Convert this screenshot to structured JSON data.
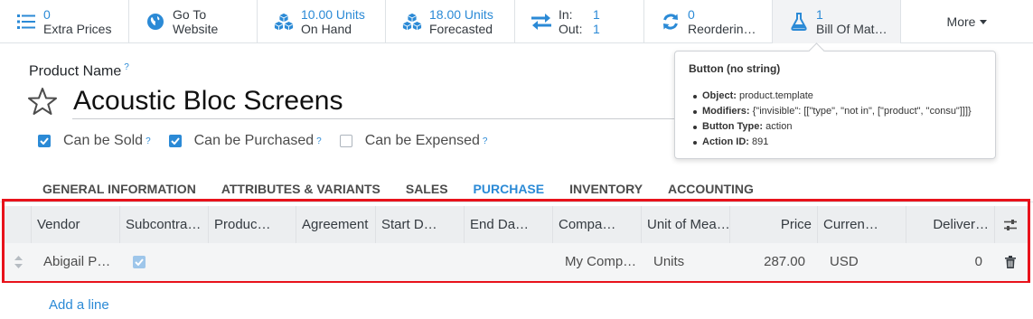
{
  "smart_buttons": {
    "extra_prices": {
      "value": "0",
      "label": "Extra Prices"
    },
    "website": {
      "line1": "Go To",
      "line2": "Website"
    },
    "on_hand": {
      "value": "10.00 Units",
      "label": "On Hand"
    },
    "forecasted": {
      "value": "18.00 Units",
      "label": "Forecasted"
    },
    "inout": {
      "in_label": "In:",
      "in_value": "1",
      "out_label": "Out:",
      "out_value": "1"
    },
    "reordering": {
      "value": "0",
      "label": "Reorderin…"
    },
    "bom": {
      "value": "1",
      "label": "Bill Of Mat…"
    },
    "more_label": "More"
  },
  "product": {
    "name_label": "Product Name",
    "help_mark": "?",
    "name": "Acoustic Bloc Screens",
    "can_be_sold": {
      "label": "Can be Sold",
      "checked": true
    },
    "can_be_purchased": {
      "label": "Can be Purchased",
      "checked": true
    },
    "can_be_expensed": {
      "label": "Can be Expensed",
      "checked": false
    }
  },
  "tabs": [
    {
      "label": "GENERAL INFORMATION"
    },
    {
      "label": "ATTRIBUTES & VARIANTS"
    },
    {
      "label": "SALES"
    },
    {
      "label": "PURCHASE",
      "active": true
    },
    {
      "label": "INVENTORY"
    },
    {
      "label": "ACCOUNTING"
    }
  ],
  "table": {
    "columns": [
      "Vendor",
      "Subcontra…",
      "Produc…",
      "Agreement",
      "Start D…",
      "End Da…",
      "Compa…",
      "Unit of Mea…",
      "Price",
      "Curren…",
      "Deliver…"
    ],
    "rows": [
      {
        "vendor": "Abigail P…",
        "subcontractor": true,
        "product": "",
        "agreement": "",
        "start": "",
        "end": "",
        "company": "My Comp…",
        "uom": "Units",
        "price": "287.00",
        "currency": "USD",
        "delivery": "0"
      }
    ],
    "add_line": "Add a line"
  },
  "tooltip": {
    "title": "Button (no string)",
    "items": [
      {
        "key": "Object:",
        "value": "product.template"
      },
      {
        "key": "Modifiers:",
        "value": "{\"invisible\": [[\"type\", \"not in\", [\"product\", \"consu\"]]]}"
      },
      {
        "key": "Button Type:",
        "value": "action"
      },
      {
        "key": "Action ID:",
        "value": "891"
      }
    ]
  },
  "colors": {
    "accent": "#2b8ad6",
    "highlight_border": "#e8121b",
    "header_bg": "#eceef0"
  }
}
